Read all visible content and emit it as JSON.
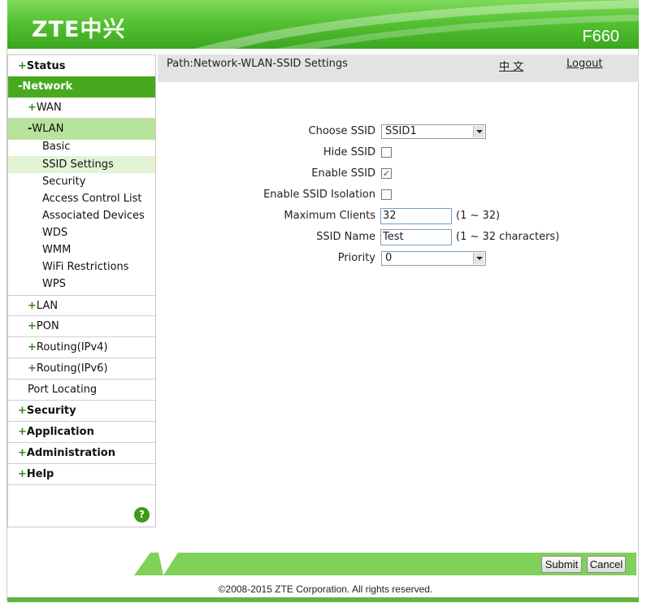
{
  "header": {
    "logo": "ZTE中兴",
    "model": "F660"
  },
  "pathbar": {
    "path": "Path:Network-WLAN-SSID Settings",
    "lang": "中 文",
    "logout": "Logout"
  },
  "sidebar": {
    "status": "Status",
    "network": "Network",
    "wan": "WAN",
    "wlan": "WLAN",
    "basic": "Basic",
    "ssid_settings": "SSID Settings",
    "security_sub": "Security",
    "acl": "Access Control List",
    "associated": "Associated Devices",
    "wds": "WDS",
    "wmm": "WMM",
    "wifi_restrictions": "WiFi Restrictions",
    "wps": "WPS",
    "lan": "LAN",
    "pon": "PON",
    "routing4": "Routing(IPv4)",
    "routing6": "Routing(IPv6)",
    "port_locating": "Port Locating",
    "security": "Security",
    "application": "Application",
    "administration": "Administration",
    "help": "Help",
    "help_icon": "?",
    "plus": "+",
    "minus": "-"
  },
  "form": {
    "choose_ssid_label": "Choose SSID",
    "choose_ssid_value": "SSID1",
    "hide_ssid_label": "Hide SSID",
    "hide_ssid_checked": false,
    "enable_ssid_label": "Enable SSID",
    "enable_ssid_checked": true,
    "isolation_label": "Enable SSID Isolation",
    "isolation_checked": false,
    "max_clients_label": "Maximum Clients",
    "max_clients_value": "32",
    "max_clients_hint": "(1 ~ 32)",
    "ssid_name_label": "SSID Name",
    "ssid_name_value": "Test",
    "ssid_name_hint": "(1 ~ 32 characters)",
    "priority_label": "Priority",
    "priority_value": "0",
    "check_mark": "✓"
  },
  "footer": {
    "submit": "Submit",
    "cancel": "Cancel",
    "copyright": "©2008-2015 ZTE Corporation. All rights reserved."
  },
  "colors": {
    "brand_green": "#48a91f",
    "active_sub": "#b8e39a",
    "active_item": "#e3f4d6"
  }
}
